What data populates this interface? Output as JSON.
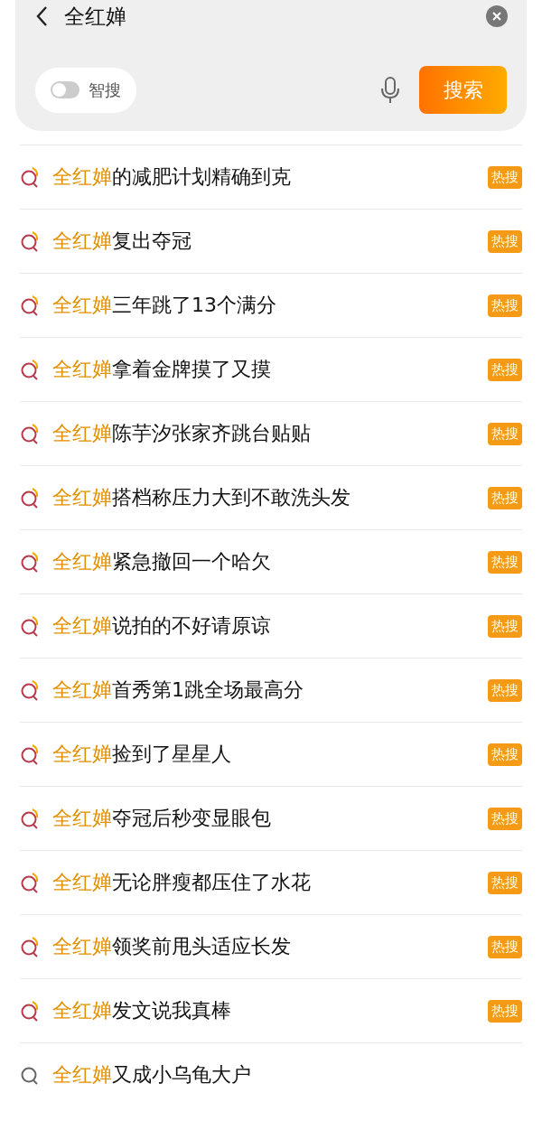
{
  "search": {
    "value": "全红婵",
    "button": "搜索"
  },
  "smart_search": {
    "label": "智搜",
    "on": false
  },
  "suggestions": [
    {
      "kind": "hot",
      "match": "全红婵",
      "rest": "的减肥计划精确到克",
      "badge": "热搜"
    },
    {
      "kind": "hot",
      "match": "全红婵",
      "rest": "复出夺冠",
      "badge": "热搜"
    },
    {
      "kind": "hot",
      "match": "全红婵",
      "rest": "三年跳了13个满分",
      "badge": "热搜"
    },
    {
      "kind": "hot",
      "match": "全红婵",
      "rest": "拿着金牌摸了又摸",
      "badge": "热搜"
    },
    {
      "kind": "hot",
      "match": "全红婵",
      "rest": "陈芋汐张家齐跳台贴贴",
      "badge": "热搜"
    },
    {
      "kind": "hot",
      "match": "全红婵",
      "rest": "搭档称压力大到不敢洗头发",
      "badge": "热搜"
    },
    {
      "kind": "hot",
      "match": "全红婵",
      "rest": "紧急撤回一个哈欠",
      "badge": "热搜"
    },
    {
      "kind": "hot",
      "match": "全红婵",
      "rest": "说拍的不好请原谅",
      "badge": "热搜"
    },
    {
      "kind": "hot",
      "match": "全红婵",
      "rest": "首秀第1跳全场最高分",
      "badge": "热搜"
    },
    {
      "kind": "hot",
      "match": "全红婵",
      "rest": "捡到了星星人",
      "badge": "热搜"
    },
    {
      "kind": "hot",
      "match": "全红婵",
      "rest": "夺冠后秒变显眼包",
      "badge": "热搜"
    },
    {
      "kind": "hot",
      "match": "全红婵",
      "rest": "无论胖瘦都压住了水花",
      "badge": "热搜"
    },
    {
      "kind": "hot",
      "match": "全红婵",
      "rest": "领奖前甩头适应长发",
      "badge": "热搜"
    },
    {
      "kind": "hot",
      "match": "全红婵",
      "rest": "发文说我真棒",
      "badge": "热搜"
    },
    {
      "kind": "plain",
      "match": "全红婵",
      "rest": "又成小乌龟大户"
    }
  ]
}
